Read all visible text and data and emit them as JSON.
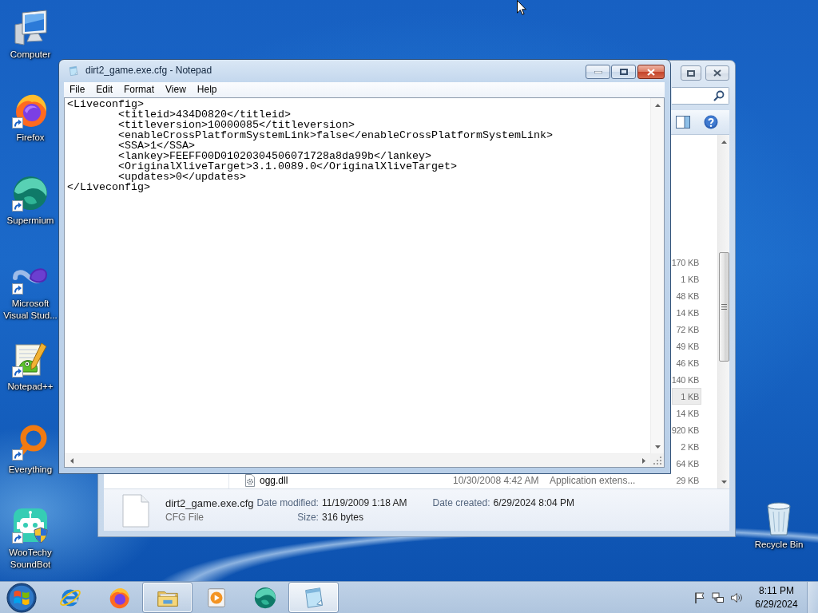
{
  "desktop_icons": [
    {
      "label": "Computer",
      "kind": "computer",
      "shortcut": false,
      "shield": false
    },
    {
      "label": "Firefox",
      "kind": "firefox",
      "shortcut": true,
      "shield": false
    },
    {
      "label": "Supermium",
      "kind": "supermium",
      "shortcut": true,
      "shield": false
    },
    {
      "label": "Microsoft Visual Stud...",
      "kind": "visual-studio",
      "shortcut": true,
      "shield": false
    },
    {
      "label": "Notepad++",
      "kind": "notepad-plus-plus",
      "shortcut": true,
      "shield": false
    },
    {
      "label": "Everything",
      "kind": "everything",
      "shortcut": true,
      "shield": false
    },
    {
      "label": "WooTechy SoundBot",
      "kind": "soundbot",
      "shortcut": true,
      "shield": true
    }
  ],
  "recycle_bin": {
    "label": "Recycle Bin",
    "kind": "recycle-bin"
  },
  "explorer_window": {
    "file_list": {
      "rows": [
        {
          "size": "170 KB",
          "selected": false
        },
        {
          "size": "1 KB",
          "selected": false
        },
        {
          "size": "48 KB",
          "selected": false
        },
        {
          "size": "14 KB",
          "selected": false
        },
        {
          "size": "72 KB",
          "selected": false
        },
        {
          "size": "49 KB",
          "selected": false
        },
        {
          "size": "46 KB",
          "selected": false
        },
        {
          "size": "140 KB",
          "selected": false
        },
        {
          "size": "1 KB",
          "selected": true
        },
        {
          "size": "14 KB",
          "selected": false
        },
        {
          "size": "920 KB",
          "selected": false
        },
        {
          "size": "2 KB",
          "selected": false
        },
        {
          "size": "64 KB",
          "selected": false
        },
        {
          "name": "ogg.dll",
          "date_modified": "10/30/2008 4:42 AM",
          "type": "Application extens...",
          "size": "29 KB",
          "selected": false
        }
      ]
    },
    "details_pane": {
      "file_name": "dirt2_game.exe.cfg",
      "file_type": "CFG File",
      "fields": [
        {
          "label": "Date modified:",
          "value": "11/19/2009 1:18 AM"
        },
        {
          "label": "Size:",
          "value": "316 bytes"
        },
        {
          "label": "Date created:",
          "value": "6/29/2024 8:04 PM"
        }
      ]
    }
  },
  "notepad_window": {
    "title": "dirt2_game.exe.cfg - Notepad",
    "menu": [
      "File",
      "Edit",
      "Format",
      "View",
      "Help"
    ],
    "lines": [
      "<Liveconfig>",
      "\t<titleid>434D0820</titleid>",
      "\t<titleversion>10000085</titleversion>",
      "\t<enableCrossPlatformSystemLink>false</enableCrossPlatformSystemLink>",
      "\t<SSA>1</SSA>",
      "\t<lankey>FEEFF00D01020304506071728a8da99b</lankey>",
      "\t<OriginalXliveTarget>3.1.0089.0</OriginalXliveTarget>",
      "\t<updates>0</updates>",
      "</Liveconfig>"
    ]
  },
  "taskbar": {
    "items": [
      {
        "kind": "internet-explorer",
        "open": false,
        "active": false
      },
      {
        "kind": "firefox",
        "open": false,
        "active": false
      },
      {
        "kind": "file-explorer",
        "open": true,
        "active": false
      },
      {
        "kind": "media-player",
        "open": false,
        "active": false
      },
      {
        "kind": "supermium",
        "open": false,
        "active": false
      },
      {
        "kind": "notepad",
        "open": true,
        "active": true
      }
    ],
    "clock": {
      "time": "8:11 PM",
      "date": "6/29/2024"
    }
  }
}
